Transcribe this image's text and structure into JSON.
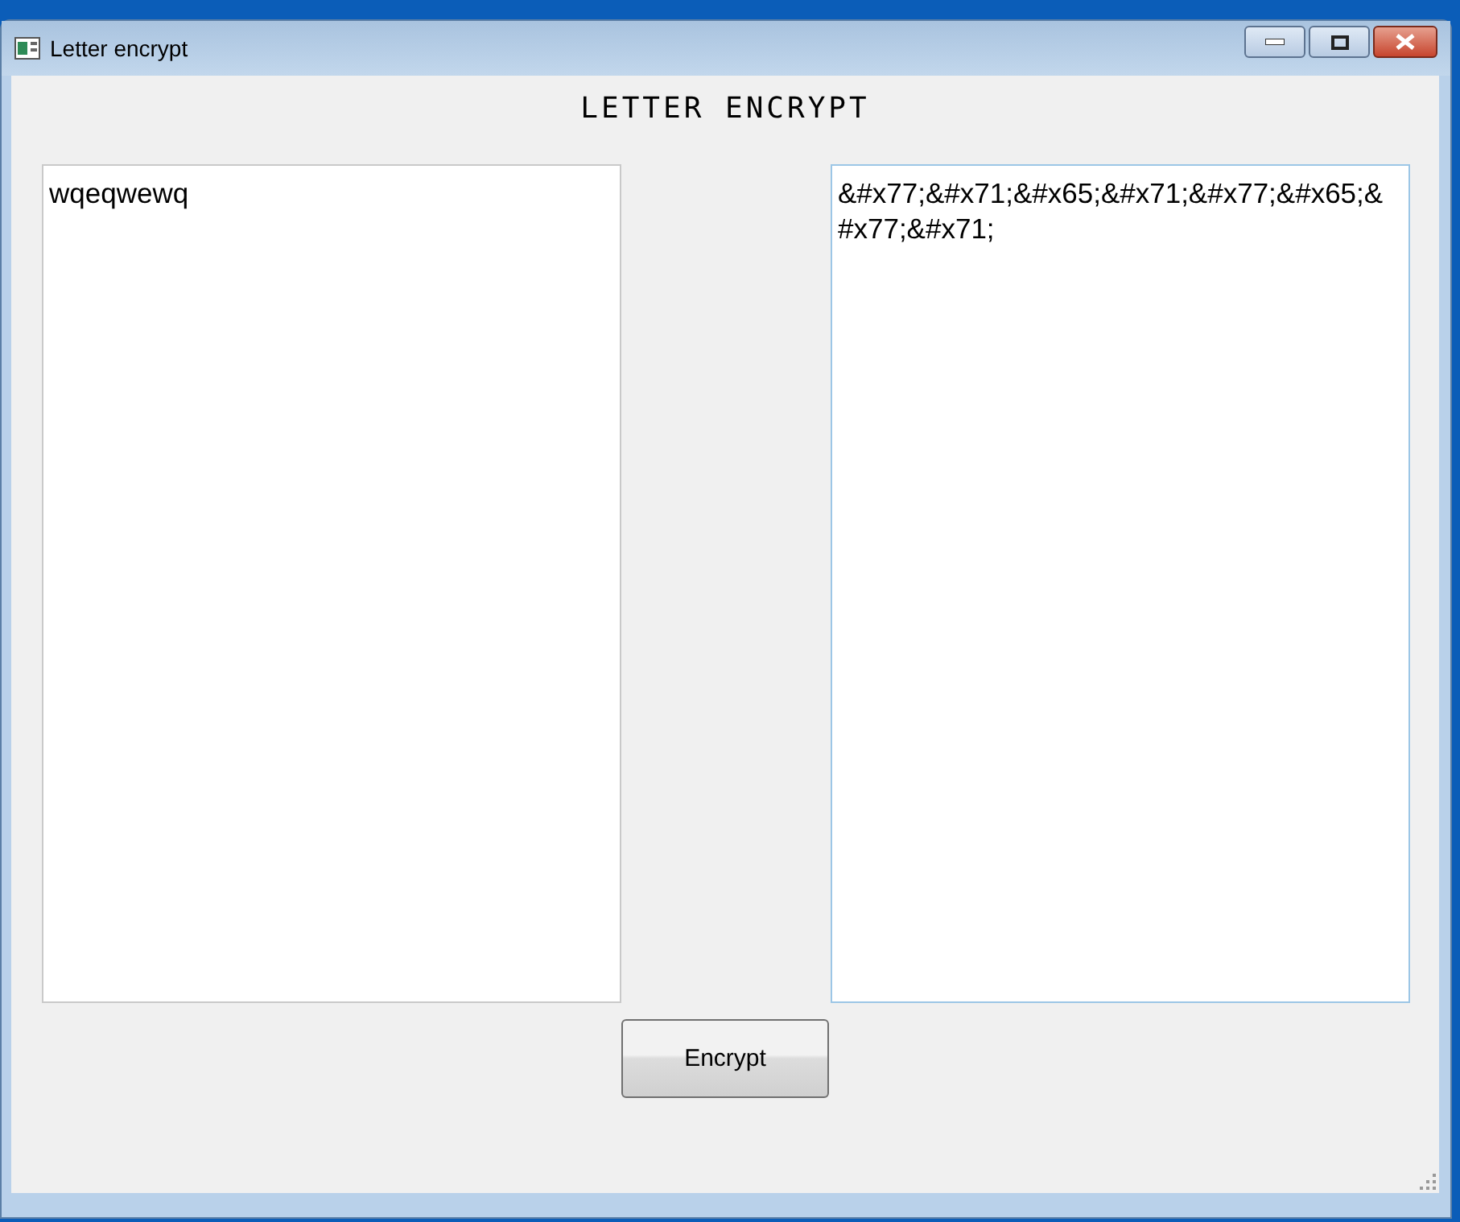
{
  "window": {
    "title": "Letter encrypt"
  },
  "heading": "LETTER ENCRYPT",
  "input": {
    "value": "wqeqwewq"
  },
  "output": {
    "value": "&#x77;&#x71;&#x65;&#x71;&#x77;&#x65;&#x77;&#x71;"
  },
  "buttons": [
    {
      "label": "Encrypt"
    }
  ]
}
